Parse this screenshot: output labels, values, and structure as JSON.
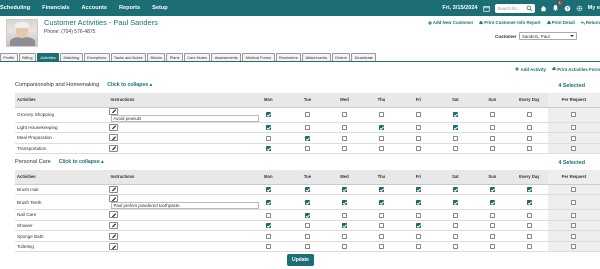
{
  "topnav": {
    "items": [
      "Scheduling",
      "Financials",
      "Accounts",
      "Reports",
      "Setup"
    ],
    "date": "Fri, 3/15/2024",
    "search_placeholder": "Search for...",
    "notification_count": "1",
    "account_label": "My e"
  },
  "header": {
    "title": "Customer Activities - Paul Sanders",
    "phone": "Phone: (704) 576-4875",
    "actions": [
      "Add New Customer",
      "Print Customer Info Report",
      "Print Detail",
      "Return"
    ],
    "customer_label": "Customer",
    "customer_value": "Sanders, Paul"
  },
  "tabs": [
    "Profile",
    "Billing",
    "Activities",
    "Matching",
    "Exceptions",
    "Tasks and Notes",
    "Blocks",
    "Plans",
    "Care Notes",
    "Assessments",
    "Medical Forms",
    "Reminders",
    "Attachments",
    "Orders",
    "Deactivate"
  ],
  "active_tab": "Activities",
  "toolbar": {
    "add_activity": "Add Activity",
    "print_forms": "Print Activities Form"
  },
  "columns": {
    "activities": "Activities",
    "instructions": "Instructions",
    "days": [
      "Mon",
      "Tue",
      "Wed",
      "Thu",
      "Fri",
      "Sat",
      "Sun"
    ],
    "every_day": "Every Day",
    "per_request": "Per Request"
  },
  "sections": [
    {
      "title": "Companionship and Homemaking",
      "collapse_label": "Click to collapse",
      "selected": "4 Selected",
      "rows": [
        {
          "name": "Grocery Shopping",
          "instruction": "Avoid peanuts",
          "checks": [
            1,
            0,
            0,
            0,
            0,
            1,
            0,
            0,
            0
          ]
        },
        {
          "name": "Light Housekeeping",
          "instruction": "",
          "checks": [
            1,
            0,
            0,
            1,
            0,
            1,
            0,
            0,
            0
          ]
        },
        {
          "name": "Meal Preparation",
          "instruction": "",
          "checks": [
            0,
            1,
            0,
            0,
            0,
            0,
            0,
            0,
            0
          ]
        },
        {
          "name": "Transportation",
          "instruction": "",
          "checks": [
            1,
            0,
            0,
            0,
            0,
            0,
            0,
            0,
            0
          ]
        }
      ]
    },
    {
      "title": "Personal Care",
      "collapse_label": "Click to collapse",
      "selected": "4 Selected",
      "rows": [
        {
          "name": "Brush Hair",
          "instruction": "",
          "checks": [
            1,
            1,
            1,
            1,
            1,
            1,
            1,
            1,
            0
          ]
        },
        {
          "name": "Brush Teeth",
          "instruction": "Paul prefers powdered toothpaste.",
          "checks": [
            1,
            1,
            1,
            1,
            1,
            1,
            1,
            1,
            0
          ]
        },
        {
          "name": "Nail Care",
          "instruction": "",
          "checks": [
            0,
            1,
            0,
            0,
            0,
            0,
            0,
            0,
            0
          ]
        },
        {
          "name": "Shower",
          "instruction": "",
          "checks": [
            1,
            0,
            1,
            0,
            1,
            0,
            0,
            0,
            0
          ]
        },
        {
          "name": "Sponge Bath",
          "instruction": "",
          "checks": [
            0,
            0,
            0,
            0,
            0,
            0,
            0,
            0,
            0
          ]
        },
        {
          "name": "Toileting",
          "instruction": "",
          "checks": [
            0,
            0,
            0,
            0,
            0,
            0,
            0,
            0,
            0
          ]
        }
      ]
    }
  ],
  "update_label": "Update",
  "colors": {
    "primary": "#1b6e74",
    "checked": "#1f6b6b"
  }
}
